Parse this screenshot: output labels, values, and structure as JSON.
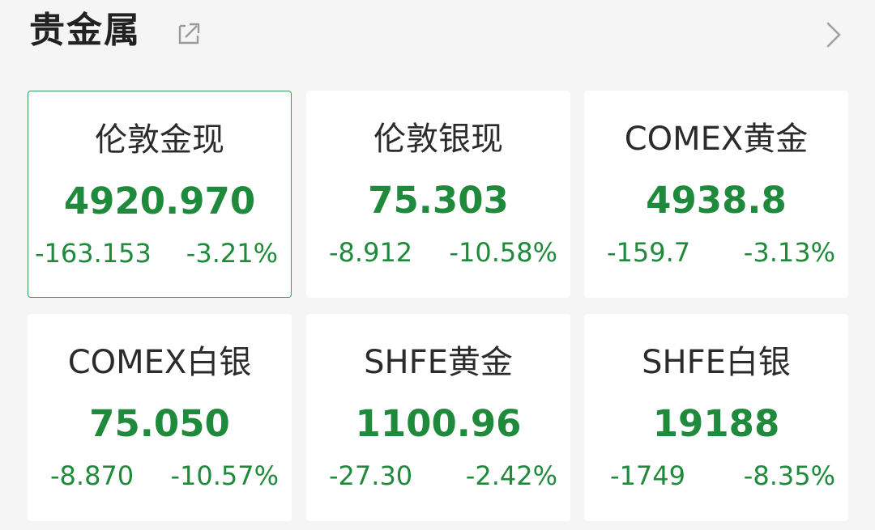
{
  "header": {
    "title": "贵金属",
    "share_icon": "share-icon",
    "more_icon": "chevron-right-icon"
  },
  "colors": {
    "down_green": "#1f8a3b",
    "selected_border": "#3b9c55",
    "background": "#f5f5f5",
    "card_background": "#ffffff"
  },
  "cards": [
    {
      "name": "伦敦金现",
      "price": "4920.970",
      "change": "-163.153",
      "pct": "-3.21%",
      "selected": true
    },
    {
      "name": "伦敦银现",
      "price": "75.303",
      "change": "-8.912",
      "pct": "-10.58%",
      "selected": false
    },
    {
      "name": "COMEX黄金",
      "price": "4938.8",
      "change": "-159.7",
      "pct": "-3.13%",
      "selected": false
    },
    {
      "name": "COMEX白银",
      "price": "75.050",
      "change": "-8.870",
      "pct": "-10.57%",
      "selected": false
    },
    {
      "name": "SHFE黄金",
      "price": "1100.96",
      "change": "-27.30",
      "pct": "-2.42%",
      "selected": false
    },
    {
      "name": "SHFE白银",
      "price": "19188",
      "change": "-1749",
      "pct": "-8.35%",
      "selected": false
    }
  ]
}
